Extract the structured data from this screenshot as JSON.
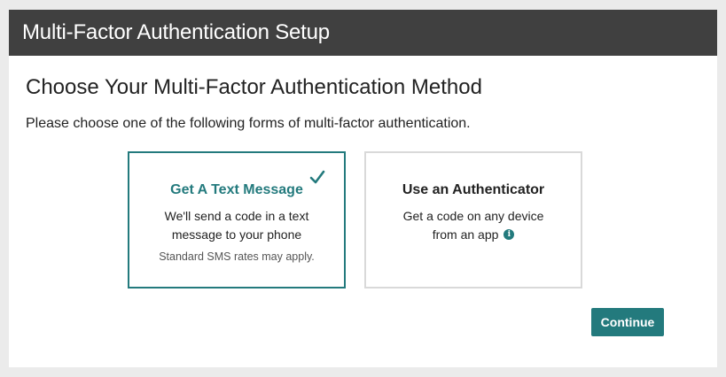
{
  "header": {
    "title": "Multi-Factor Authentication Setup"
  },
  "main": {
    "heading": "Choose Your Multi-Factor Authentication Method",
    "instructions": "Please choose one of the following forms of multi-factor authentication."
  },
  "options": [
    {
      "title": "Get A Text Message",
      "description": "We'll send a code in a text message to your phone",
      "note": "Standard SMS rates may apply.",
      "selected": true,
      "icon": "checkmark-icon"
    },
    {
      "title": "Use an Authenticator",
      "description": "Get a code on any device from an app",
      "selected": false,
      "icon": "info-icon"
    }
  ],
  "actions": {
    "continue_label": "Continue"
  },
  "colors": {
    "header_bg": "#404040",
    "accent": "#237a7d",
    "page_bg": "#ebebeb"
  }
}
